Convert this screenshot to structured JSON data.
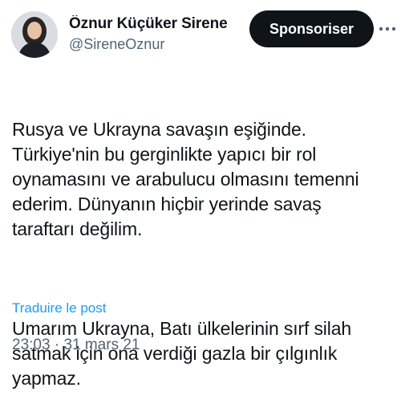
{
  "author": {
    "display_name": "Öznur Küçüker Sirene",
    "handle": "@SireneOznur"
  },
  "actions": {
    "sponsor_label": "Sponsoriser",
    "more_icon": "more-horizontal-icon"
  },
  "tweet": {
    "paragraphs": [
      "Rusya ve Ukrayna savaşın eşiğinde.\nTürkiye'nin bu gerginlikte yapıcı bir rol\noynamasını ve arabulucu olmasını temenni\nederim. Dünyanın hiçbir yerinde savaş\ntaraftarı değilim.",
      "Umarım Ukrayna, Batı ülkelerinin sırf silah\nsatmak için ona verdiği gazla bir çılgınlık\nyapmaz."
    ],
    "translate_label": "Traduire le post",
    "time": "23:03",
    "separator": "·",
    "date": "31 mars 21"
  },
  "colors": {
    "text": "#0f1419",
    "secondary": "#536471",
    "link": "#1d9bf0",
    "button_bg": "#0f1419"
  }
}
